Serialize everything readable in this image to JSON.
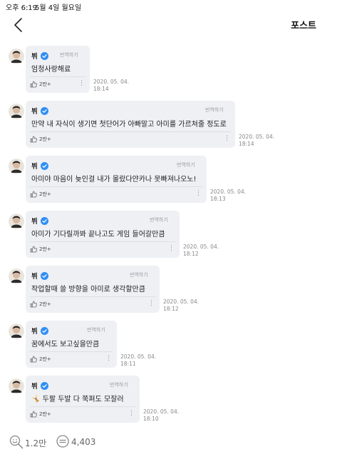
{
  "status_bar": {
    "time": "오후 6:19",
    "date": "5월 4일 월요일"
  },
  "header": {
    "back_icon": "chevron-left-icon",
    "title": "포스트"
  },
  "posts": [
    {
      "author": "뷔",
      "translate": "번역하기",
      "content": "엄청사랑해료",
      "likes": "2만+",
      "date": "2020. 05. 04.",
      "time": "18:14"
    },
    {
      "author": "뷔",
      "translate": "번역하기",
      "content": "만약 내 자식이 생기면 첫단어가 아빠말고 아미를 가르쳐줄 정도로",
      "likes": "2만+",
      "date": "2020. 05. 04.",
      "time": "18:14"
    },
    {
      "author": "뷔",
      "translate": "번역하기",
      "content": "아미야 마음이 늦인걸 내가 몰랐다얀카나 못빠져나오노!",
      "likes": "2만+",
      "date": "2020. 05. 04.",
      "time": "18:13"
    },
    {
      "author": "뷔",
      "translate": "번역하기",
      "content": "아미가 기다릴까봐 끝나고도 게임 들어갈만큼",
      "likes": "2만+",
      "date": "2020. 05. 04.",
      "time": "18:12"
    },
    {
      "author": "뷔",
      "translate": "번역하기",
      "content": "작업할때 쓸 방향을 아미로 생각할만큼",
      "likes": "2만+",
      "date": "2020. 05. 04.",
      "time": "18:12"
    },
    {
      "author": "뷔",
      "translate": "번역하기",
      "content": "꿈에서도 보고싶을만큼",
      "likes": "2만+",
      "date": "2020. 05. 04.",
      "time": "18:11"
    },
    {
      "author": "뷔",
      "translate": "번역하기",
      "content": "🤸 두팔 두발 다 쭉펴도 모잘러",
      "likes": "2만+",
      "date": "2020. 05. 04.",
      "time": "18:10"
    }
  ],
  "footer": {
    "like_count": "1.2만",
    "comment_count": "4,403"
  },
  "colors": {
    "bubble": "#eef0f4",
    "verified": "#2f8ef5",
    "meta_text": "#888888"
  }
}
